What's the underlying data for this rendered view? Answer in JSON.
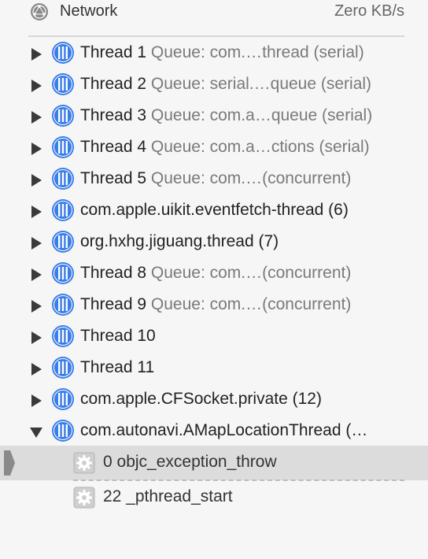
{
  "network": {
    "label": "Network",
    "value": "Zero KB/s"
  },
  "threads": [
    {
      "name": "Thread 1",
      "queue": "Queue: com.…thread (serial)",
      "expanded": false
    },
    {
      "name": "Thread 2",
      "queue": "Queue: serial.…queue (serial)",
      "expanded": false
    },
    {
      "name": "Thread 3",
      "queue": "Queue: com.a…queue (serial)",
      "expanded": false
    },
    {
      "name": "Thread 4",
      "queue": "Queue: com.a…ctions (serial)",
      "expanded": false
    },
    {
      "name": "Thread 5",
      "queue": "Queue: com.…(concurrent)",
      "expanded": false
    },
    {
      "name": "com.apple.uikit.eventfetch-thread (6)",
      "queue": "",
      "expanded": false
    },
    {
      "name": "org.hxhg.jiguang.thread (7)",
      "queue": "",
      "expanded": false
    },
    {
      "name": "Thread 8",
      "queue": "Queue: com.…(concurrent)",
      "expanded": false
    },
    {
      "name": "Thread 9",
      "queue": "Queue: com.…(concurrent)",
      "expanded": false
    },
    {
      "name": "Thread 10",
      "queue": "",
      "expanded": false
    },
    {
      "name": "Thread 11",
      "queue": "",
      "expanded": false
    },
    {
      "name": "com.apple.CFSocket.private (12)",
      "queue": "",
      "expanded": false
    },
    {
      "name": "com.autonavi.AMapLocationThread (…",
      "queue": "",
      "expanded": true
    }
  ],
  "frames": [
    {
      "label": "0 objc_exception_throw",
      "selected": true
    },
    {
      "label": "22 _pthread_start",
      "selected": false
    }
  ],
  "colors": {
    "thread_blue": "#3a7de8",
    "selection": "#dcdcdc"
  }
}
